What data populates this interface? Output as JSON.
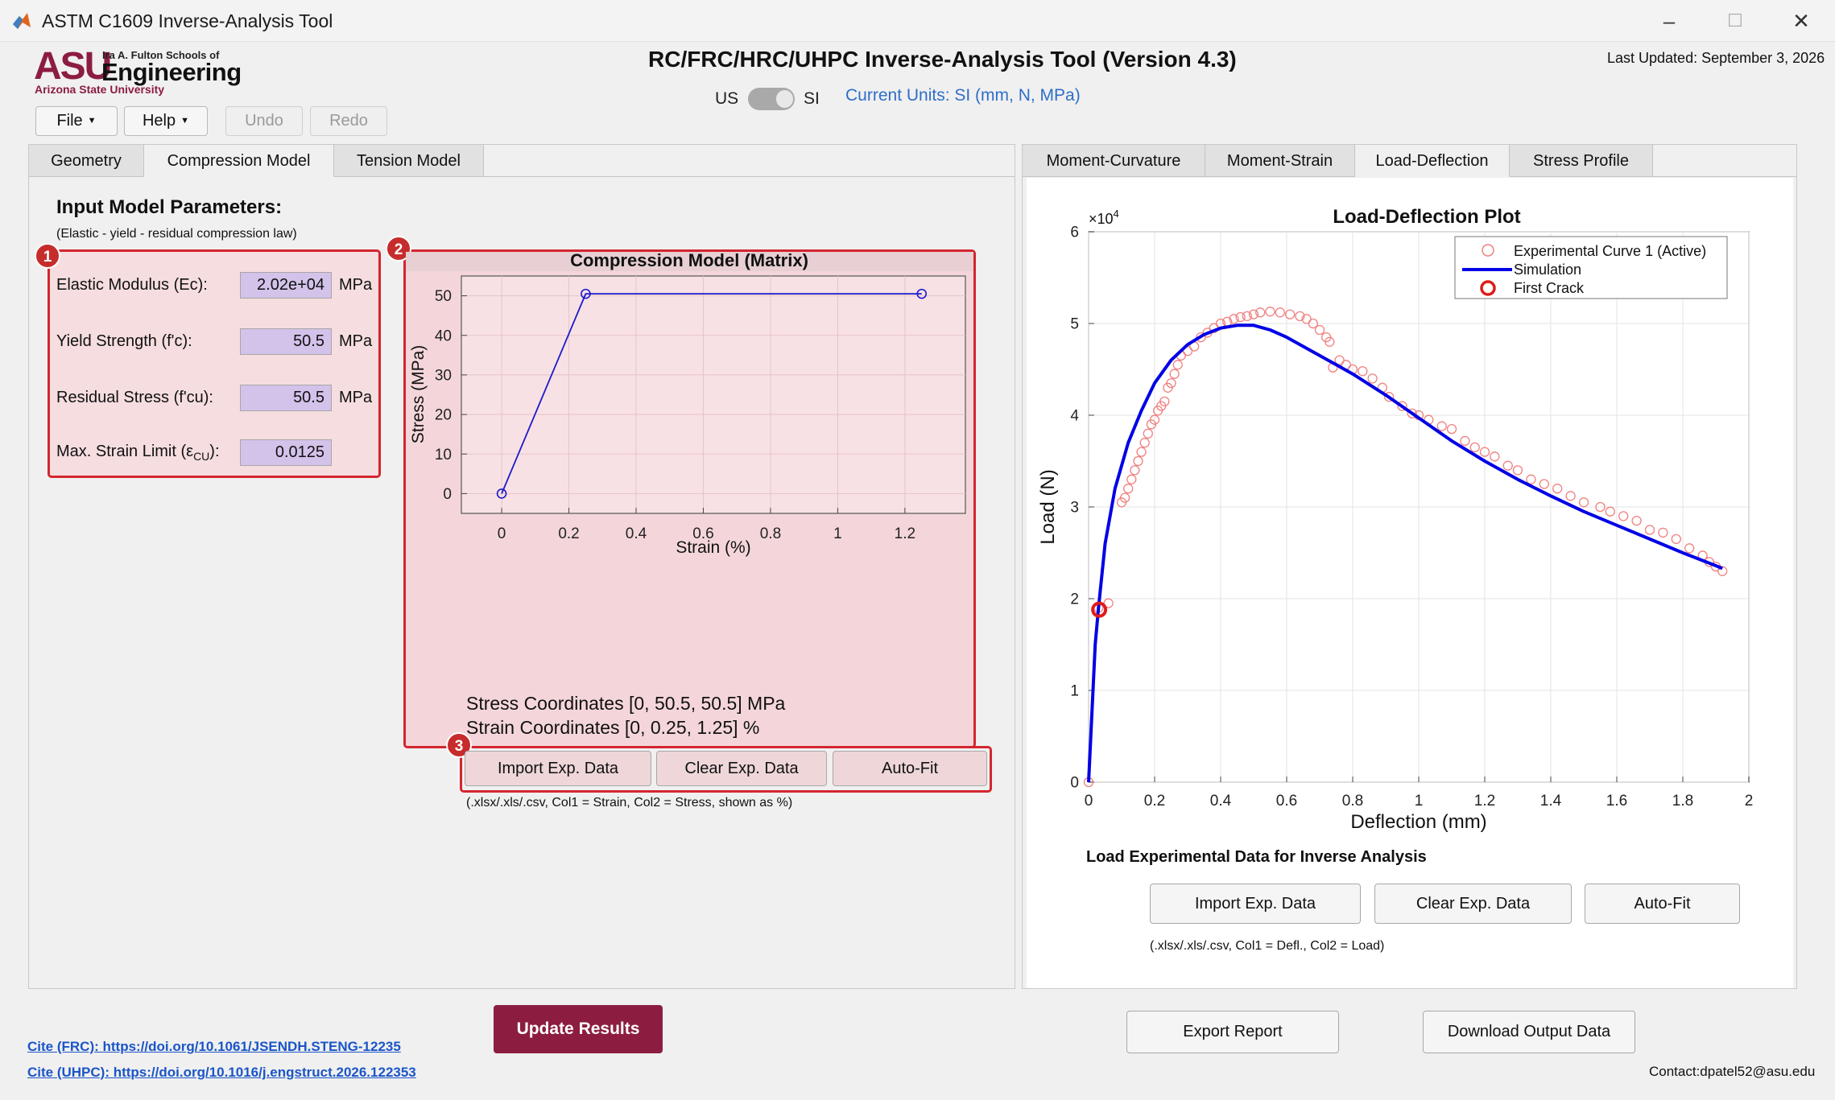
{
  "window": {
    "title": "ASTM C1609 Inverse-Analysis Tool",
    "minimize": "–",
    "maximize": "☐",
    "close": "✕"
  },
  "logo": {
    "asu": "ASU",
    "fulton": "Ira A. Fulton Schools of",
    "engineering": "Engineering",
    "university": "Arizona State University"
  },
  "header": {
    "title": "RC/FRC/HRC/UHPC Inverse-Analysis Tool (Version 4.3)",
    "last_updated": "Last Updated: September 3, 2026",
    "unit_left": "US",
    "unit_right": "SI",
    "unit_toggle_state": "SI",
    "current_units": "Current Units: SI (mm, N, MPa)"
  },
  "toolbar": {
    "file": "File",
    "help": "Help",
    "undo": "Undo",
    "redo": "Redo"
  },
  "left_tabs": [
    "Geometry",
    "Compression Model",
    "Tension Model"
  ],
  "left_active_tab": "Compression Model",
  "input": {
    "heading": "Input Model Parameters:",
    "law": "(Elastic - yield - residual compression law)",
    "params": [
      {
        "label": "Elastic Modulus (Ec):",
        "value": "2.02e+04",
        "unit": "MPa"
      },
      {
        "label": "Yield Strength (f'c):",
        "value": "50.5",
        "unit": "MPa"
      },
      {
        "label": "Residual Stress (f'cu):",
        "value": "50.5",
        "unit": "MPa"
      },
      {
        "label_main": "Max. Strain Limit (ε",
        "label_sub": "CU",
        "label_end": "):",
        "value": "0.0125",
        "unit": ""
      }
    ]
  },
  "badges": [
    "1",
    "2",
    "3"
  ],
  "compression": {
    "stress_coords": "Stress Coordinates [0, 50.5, 50.5] MPa",
    "strain_coords": "Strain Coordinates [0, 0.25, 1.25] %",
    "import_btn": "Import Exp. Data",
    "clear_btn": "Clear Exp. Data",
    "autofit_btn": "Auto-Fit",
    "hint": "(.xlsx/.xls/.csv, Col1 = Strain, Col2 = Stress, shown as %)"
  },
  "right_tabs": [
    "Moment-Curvature",
    "Moment-Strain",
    "Load-Deflection",
    "Stress Profile"
  ],
  "right_active_tab": "Load-Deflection",
  "load": {
    "heading": "Load Experimental Data for Inverse Analysis",
    "import_btn": "Import Exp. Data",
    "clear_btn": "Clear Exp. Data",
    "autofit_btn": "Auto-Fit",
    "hint": "(.xlsx/.xls/.csv, Col1 = Defl., Col2 = Load)"
  },
  "actions": {
    "update": "Update Results",
    "export": "Export Report",
    "download": "Download Output Data"
  },
  "footer": {
    "cite_frc": "Cite (FRC): https://doi.org/10.1061/JSENDH.STENG-12235",
    "cite_uhpc": "Cite (UHPC): https://doi.org/10.1016/j.engstruct.2026.122353",
    "contact": "Contact:dpatel52@asu.edu"
  },
  "colors": {
    "asu_maroon": "#8c1d40",
    "accent_blue": "#2f6ec7",
    "param_fill": "#d3c2ea",
    "highlight_red": "#d3262f",
    "sim_blue": "#0000e6",
    "exp_red": "#f08080"
  },
  "chart_data": [
    {
      "type": "line",
      "title": "Compression Model (Matrix)",
      "xlabel": "Strain (%)",
      "ylabel": "Stress (MPa)",
      "xlim": [
        -0.12,
        1.38
      ],
      "ylim": [
        -5,
        55
      ],
      "xticks": [
        0,
        0.2,
        0.4,
        0.6,
        0.8,
        1,
        1.2
      ],
      "xtick_labels": [
        "0",
        "0.2",
        "0.4",
        "0.6",
        "0.8",
        "1",
        "1.2"
      ],
      "yticks": [
        0,
        10,
        20,
        30,
        40,
        50
      ],
      "ytick_labels": [
        "0",
        "10",
        "20",
        "30",
        "40",
        "50"
      ],
      "grid": true,
      "series": [
        {
          "x": [
            0,
            0.25,
            1.25
          ],
          "y": [
            0,
            50.5,
            50.5
          ],
          "color": "#1a1acc",
          "markers": "circle"
        }
      ]
    },
    {
      "type": "line",
      "title": "Load-Deflection Plot",
      "xlabel": "Deflection (mm)",
      "ylabel": "Load (N)",
      "y_exponent": "×10",
      "y_exponent_power": "4",
      "xlim": [
        0,
        2
      ],
      "ylim": [
        0,
        6
      ],
      "xticks": [
        0,
        0.2,
        0.4,
        0.6,
        0.8,
        1,
        1.2,
        1.4,
        1.6,
        1.8,
        2
      ],
      "xtick_labels": [
        "0",
        "0.2",
        "0.4",
        "0.6",
        "0.8",
        "1",
        "1.2",
        "1.4",
        "1.6",
        "1.8",
        "2"
      ],
      "yticks": [
        0,
        1,
        2,
        3,
        4,
        5,
        6
      ],
      "ytick_labels": [
        "0",
        "1",
        "2",
        "3",
        "4",
        "5",
        "6"
      ],
      "y_unit_scale": 10000,
      "grid": true,
      "legend_position": "top-right",
      "series": [
        {
          "name": "Experimental Curve 1 (Active)",
          "kind": "scatter",
          "color": "#f08080",
          "x": [
            0.0,
            0.03,
            0.06,
            0.1,
            0.11,
            0.12,
            0.13,
            0.14,
            0.15,
            0.16,
            0.17,
            0.18,
            0.19,
            0.2,
            0.21,
            0.22,
            0.23,
            0.24,
            0.25,
            0.26,
            0.27,
            0.28,
            0.3,
            0.32,
            0.34,
            0.36,
            0.38,
            0.4,
            0.42,
            0.44,
            0.46,
            0.48,
            0.5,
            0.52,
            0.55,
            0.58,
            0.61,
            0.64,
            0.66,
            0.68,
            0.7,
            0.72,
            0.73,
            0.74,
            0.76,
            0.78,
            0.8,
            0.83,
            0.86,
            0.89,
            0.91,
            0.95,
            0.98,
            1.0,
            1.03,
            1.07,
            1.1,
            1.14,
            1.17,
            1.2,
            1.23,
            1.27,
            1.3,
            1.34,
            1.38,
            1.42,
            1.46,
            1.5,
            1.55,
            1.58,
            1.62,
            1.66,
            1.7,
            1.74,
            1.78,
            1.82,
            1.86,
            1.88,
            1.9,
            1.92
          ],
          "y": [
            0.0,
            1.9,
            1.95,
            3.05,
            3.1,
            3.2,
            3.3,
            3.4,
            3.5,
            3.6,
            3.7,
            3.8,
            3.9,
            3.95,
            4.05,
            4.1,
            4.15,
            4.3,
            4.35,
            4.45,
            4.55,
            4.65,
            4.7,
            4.75,
            4.85,
            4.9,
            4.95,
            5.0,
            5.02,
            5.05,
            5.07,
            5.08,
            5.1,
            5.12,
            5.13,
            5.12,
            5.1,
            5.08,
            5.05,
            5.0,
            4.93,
            4.85,
            4.8,
            4.52,
            4.6,
            4.55,
            4.5,
            4.48,
            4.4,
            4.3,
            4.2,
            4.1,
            4.02,
            4.0,
            3.95,
            3.88,
            3.85,
            3.72,
            3.65,
            3.6,
            3.55,
            3.45,
            3.4,
            3.3,
            3.25,
            3.2,
            3.12,
            3.05,
            3.0,
            2.95,
            2.9,
            2.85,
            2.75,
            2.72,
            2.65,
            2.55,
            2.47,
            2.4,
            2.35,
            2.3
          ]
        },
        {
          "name": "Simulation",
          "kind": "line",
          "color": "#0000e6",
          "x": [
            0,
            0.02,
            0.03,
            0.05,
            0.08,
            0.12,
            0.16,
            0.2,
            0.25,
            0.3,
            0.35,
            0.4,
            0.45,
            0.5,
            0.55,
            0.6,
            0.65,
            0.7,
            0.75,
            0.8,
            0.9,
            1.0,
            1.1,
            1.2,
            1.3,
            1.4,
            1.5,
            1.6,
            1.7,
            1.8,
            1.9,
            1.92
          ],
          "y": [
            0,
            1.5,
            1.9,
            2.6,
            3.2,
            3.7,
            4.05,
            4.35,
            4.6,
            4.77,
            4.88,
            4.95,
            4.98,
            4.98,
            4.93,
            4.85,
            4.75,
            4.65,
            4.55,
            4.45,
            4.22,
            3.97,
            3.72,
            3.5,
            3.3,
            3.12,
            2.95,
            2.8,
            2.65,
            2.5,
            2.36,
            2.33
          ]
        },
        {
          "name": "First Crack",
          "kind": "marker",
          "color": "#e01b1b",
          "x": [
            0.032
          ],
          "y": [
            1.88
          ]
        }
      ]
    }
  ]
}
